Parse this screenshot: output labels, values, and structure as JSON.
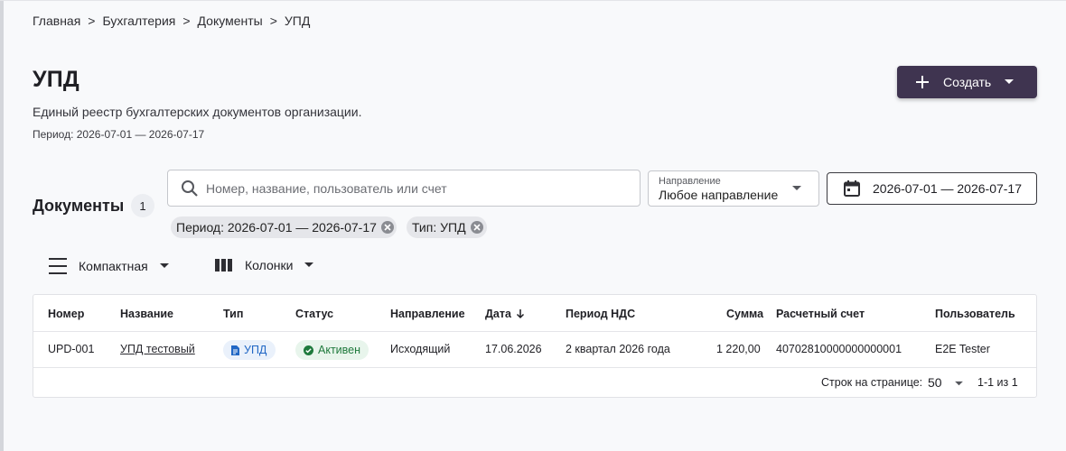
{
  "breadcrumb": [
    "Главная",
    "Бухгалтерия",
    "Документы",
    "УПД"
  ],
  "breadcrumb_separator": ">",
  "page": {
    "title": "УПД",
    "subtitle": "Единый реестр бухгалтерских документов организации.",
    "period": "Период: 2026-07-01 — 2026-07-17"
  },
  "create_button": {
    "label": "Создать",
    "icon": "plus-icon"
  },
  "documents": {
    "title": "Документы",
    "count": "1"
  },
  "search": {
    "placeholder": "Номер, название, пользователь или счет",
    "value": ""
  },
  "direction_filter": {
    "caption": "Направление",
    "value": "Любое направление"
  },
  "date_range": {
    "value": "2026-07-01 — 2026-07-17"
  },
  "chips": [
    {
      "label": "Период: 2026-07-01 — 2026-07-17"
    },
    {
      "label": "Тип: УПД"
    }
  ],
  "toolbar": {
    "density_label": "Компактная",
    "columns_label": "Колонки"
  },
  "table": {
    "headers": [
      "Номер",
      "Название",
      "Тип",
      "Статус",
      "Направление",
      "Дата",
      "Период НДС",
      "Сумма",
      "Расчетный счет",
      "Пользователь"
    ],
    "sort_column": "Дата",
    "sort_direction": "desc",
    "rows": [
      {
        "number": "UPD-001",
        "name": "УПД тестовый",
        "type": "УПД",
        "status": "Активен",
        "direction": "Исходящий",
        "date": "17.06.2026",
        "vat_period": "2 квартал 2026 года",
        "amount": "1 220,00",
        "account": "40702810000000000001",
        "user": "E2E Tester"
      }
    ]
  },
  "pagination": {
    "rows_per_page_label": "Строк на странице:",
    "rows_per_page": "50",
    "range": "1-1 из 1"
  },
  "colors": {
    "primary": "#3f3450",
    "type_badge_text": "#2167c5",
    "type_badge_bg": "#eaf1fb",
    "status_badge_text": "#1f7a3d",
    "status_badge_bg": "#e8f5ec"
  }
}
